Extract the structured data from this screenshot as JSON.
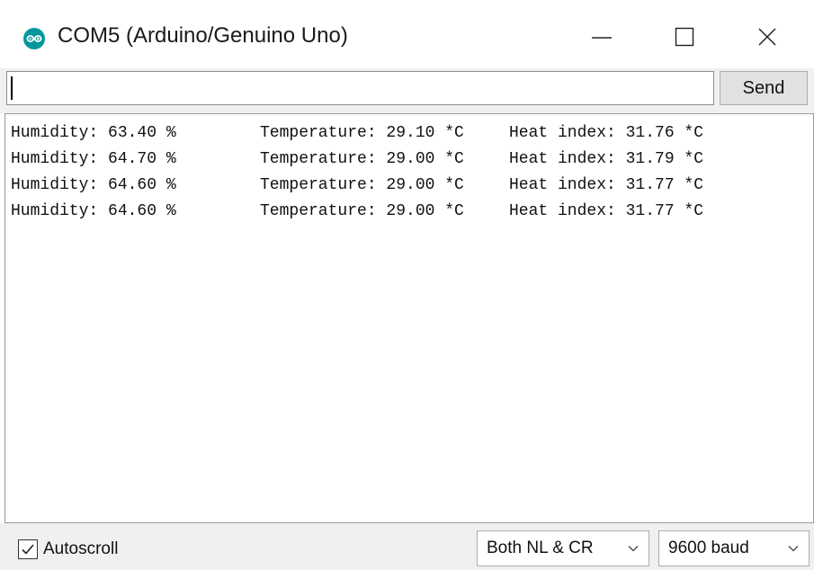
{
  "window": {
    "title": "COM5 (Arduino/Genuino Uno)"
  },
  "send_row": {
    "input_value": "",
    "send_label": "Send"
  },
  "output": {
    "lines": [
      {
        "humidity": "Humidity: 63.40 %",
        "temperature": "Temperature: 29.10 *C",
        "heat_index": "Heat index: 31.76 *C"
      },
      {
        "humidity": "Humidity: 64.70 %",
        "temperature": "Temperature: 29.00 *C",
        "heat_index": "Heat index: 31.79 *C"
      },
      {
        "humidity": "Humidity: 64.60 %",
        "temperature": "Temperature: 29.00 *C",
        "heat_index": "Heat index: 31.77 *C"
      },
      {
        "humidity": "Humidity: 64.60 %",
        "temperature": "Temperature: 29.00 *C",
        "heat_index": "Heat index: 31.77 *C"
      }
    ]
  },
  "bottom": {
    "autoscroll_label": "Autoscroll",
    "autoscroll_checked": true,
    "line_ending": "Both NL & CR",
    "baud": "9600 baud"
  },
  "colors": {
    "arduino_teal": "#00979c"
  },
  "icons": {
    "app": "arduino-icon",
    "minimize": "minimize-icon",
    "maximize": "maximize-icon",
    "close": "close-icon"
  }
}
